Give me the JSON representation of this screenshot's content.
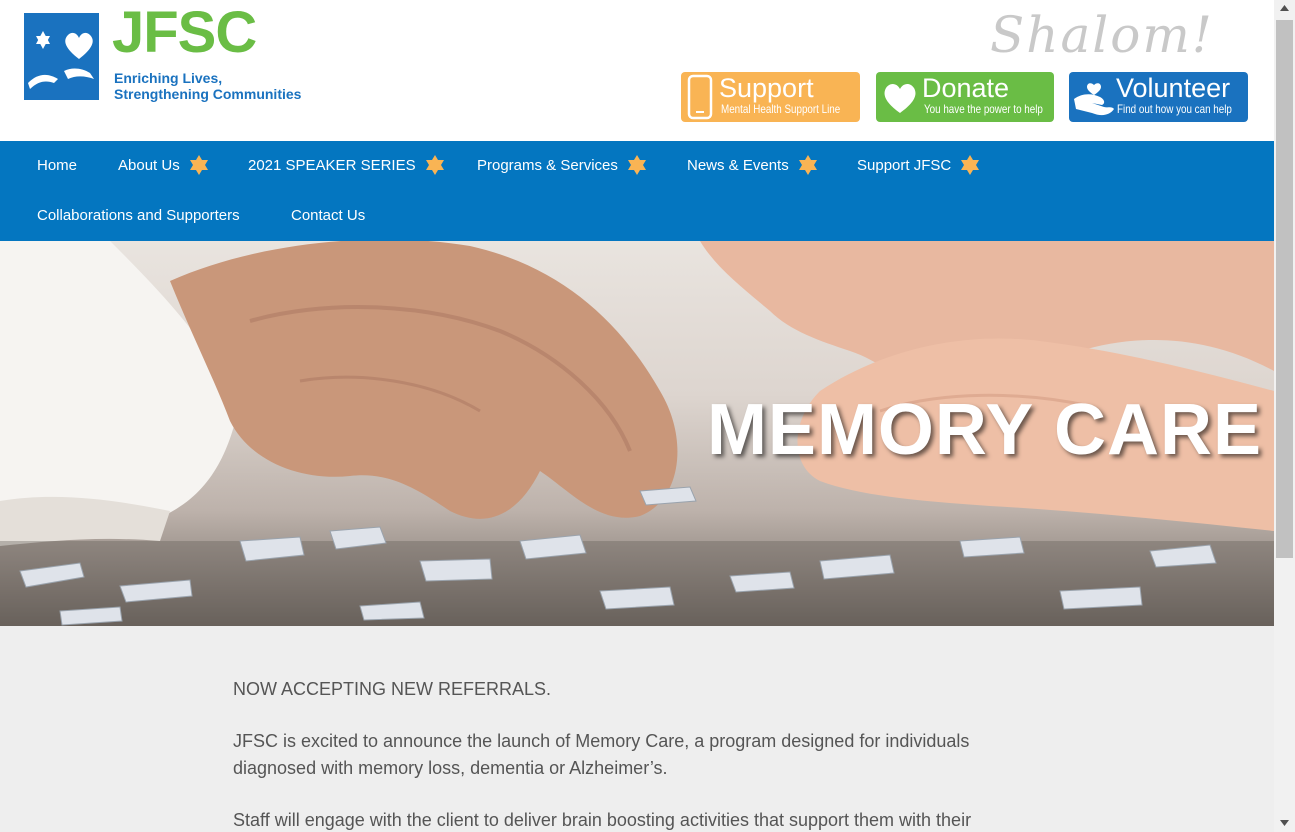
{
  "brand": {
    "name": "JFSC",
    "tagline_line1": "Enriching Lives,",
    "tagline_line2": "Strengthening Communities",
    "greeting": "Shalom!",
    "colors": {
      "blue": "#1a72bf",
      "green": "#6abd45",
      "orange": "#f9b454",
      "nav": "#0476c0"
    }
  },
  "cta_buttons": [
    {
      "title": "Support",
      "subtitle": "Mental Health Support Line",
      "icon": "phone-icon"
    },
    {
      "title": "Donate",
      "subtitle": "You have the power to help",
      "icon": "heart-icon"
    },
    {
      "title": "Volunteer",
      "subtitle": "Find out how you can help",
      "icon": "helping-hand-icon"
    }
  ],
  "nav": {
    "items": [
      {
        "label": "Home",
        "has_submenu": false
      },
      {
        "label": "About Us",
        "has_submenu": true
      },
      {
        "label": "2021 SPEAKER SERIES",
        "has_submenu": true
      },
      {
        "label": "Programs & Services",
        "has_submenu": true
      },
      {
        "label": "News & Events",
        "has_submenu": true
      },
      {
        "label": "Support JFSC",
        "has_submenu": true
      },
      {
        "label": "Collaborations and Supporters",
        "has_submenu": false
      },
      {
        "label": "Contact Us",
        "has_submenu": false
      }
    ],
    "submenu_icon": "star-of-david-icon"
  },
  "hero": {
    "title": "MEMORY CARE"
  },
  "content": {
    "paragraphs": [
      "NOW ACCEPTING NEW REFERRALS.",
      "JFSC is excited to announce the launch of Memory Care, a program designed for individuals diagnosed with memory loss, dementia or Alzheimer’s.",
      "Staff will engage with the client to deliver brain boosting activities that support them with their"
    ]
  }
}
